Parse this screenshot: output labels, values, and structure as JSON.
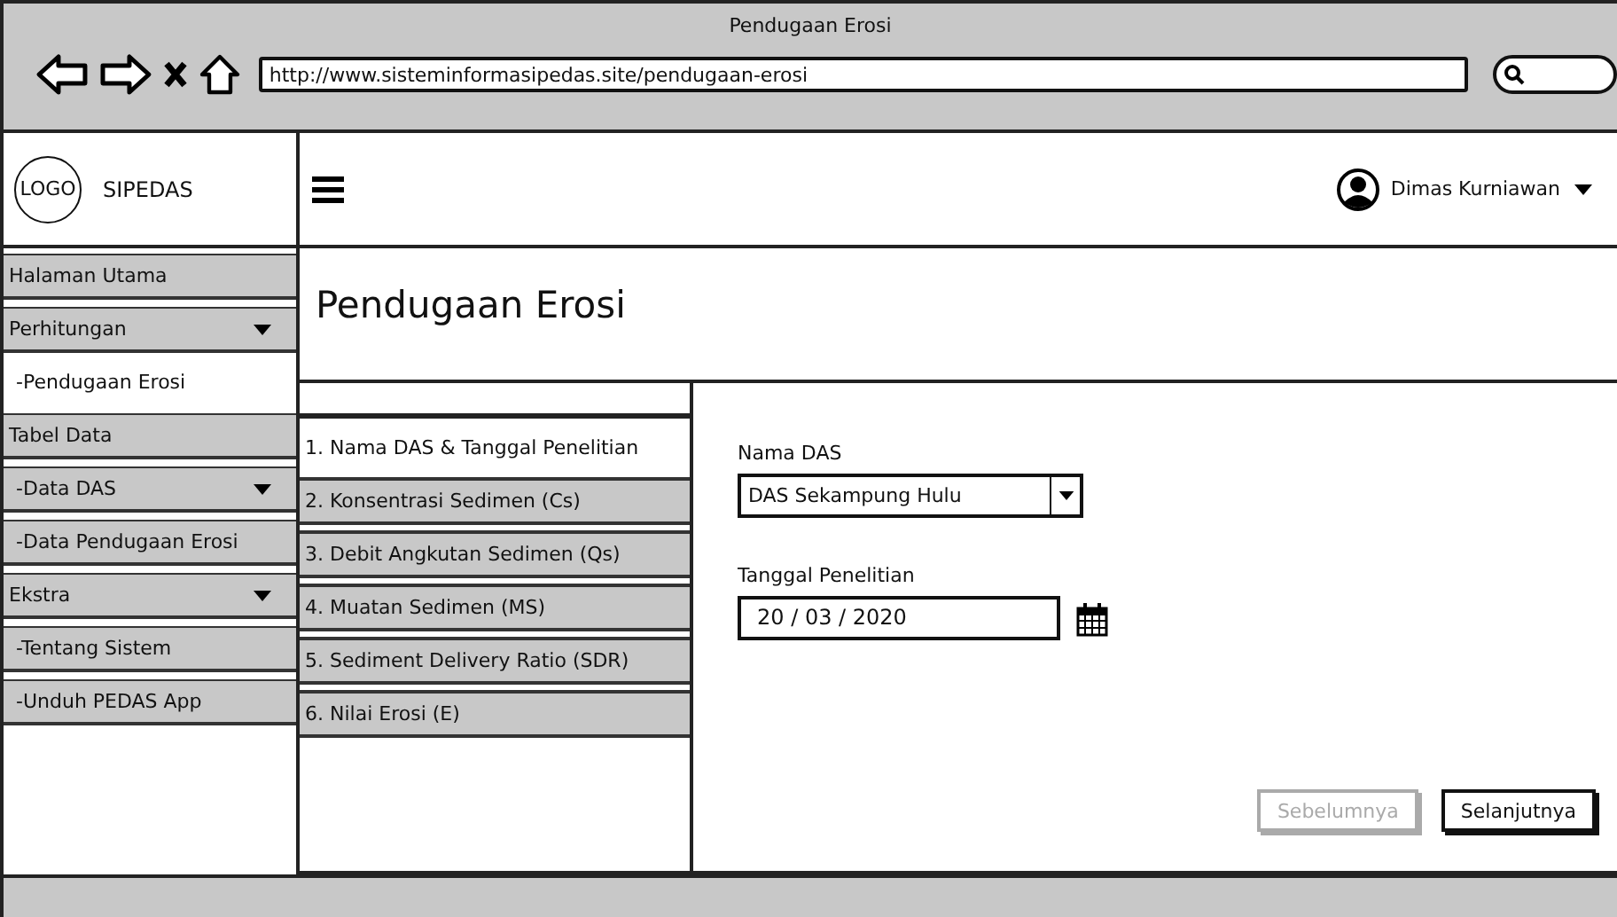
{
  "browser": {
    "title": "Pendugaan Erosi",
    "url": "http://www.sisteminformasipedas.site/pendugaan-erosi"
  },
  "header": {
    "logo": "LOGO",
    "app_name": "SIPEDAS",
    "user": "Dimas Kurniawan"
  },
  "sidebar": {
    "items": [
      {
        "label": "Halaman Utama",
        "kind": "top",
        "dropdown": false,
        "selected": false
      },
      {
        "label": "Perhitungan",
        "kind": "top",
        "dropdown": true,
        "selected": false
      },
      {
        "label": "-Pendugaan Erosi",
        "kind": "sub",
        "dropdown": false,
        "selected": true
      },
      {
        "label": "Tabel Data",
        "kind": "top",
        "dropdown": false,
        "selected": false
      },
      {
        "label": "-Data DAS",
        "kind": "sub",
        "dropdown": true,
        "selected": false
      },
      {
        "label": "-Data Pendugaan Erosi",
        "kind": "sub",
        "dropdown": false,
        "selected": false
      },
      {
        "label": "Ekstra",
        "kind": "top",
        "dropdown": true,
        "selected": false
      },
      {
        "label": "-Tentang Sistem",
        "kind": "sub",
        "dropdown": false,
        "selected": false
      },
      {
        "label": "-Unduh PEDAS App",
        "kind": "sub",
        "dropdown": false,
        "selected": false
      }
    ]
  },
  "page_title": "Pendugaan Erosi",
  "steps": [
    {
      "label": "1. Nama DAS & Tanggal Penelitian",
      "selected": true
    },
    {
      "label": "2. Konsentrasi Sedimen (Cs)",
      "selected": false
    },
    {
      "label": "3. Debit Angkutan Sedimen (Qs)",
      "selected": false
    },
    {
      "label": "4. Muatan Sedimen (MS)",
      "selected": false
    },
    {
      "label": "5. Sediment Delivery Ratio (SDR)",
      "selected": false
    },
    {
      "label": "6. Nilai Erosi (E)",
      "selected": false
    }
  ],
  "form": {
    "das_label": "Nama DAS",
    "das_value": "DAS Sekampung Hulu",
    "date_label": "Tanggal Penelitian",
    "date_value": "20 / 03 / 2020"
  },
  "buttons": [
    {
      "label": "Sebelumnya",
      "disabled": true
    },
    {
      "label": "Selanjutnya",
      "disabled": false
    }
  ]
}
